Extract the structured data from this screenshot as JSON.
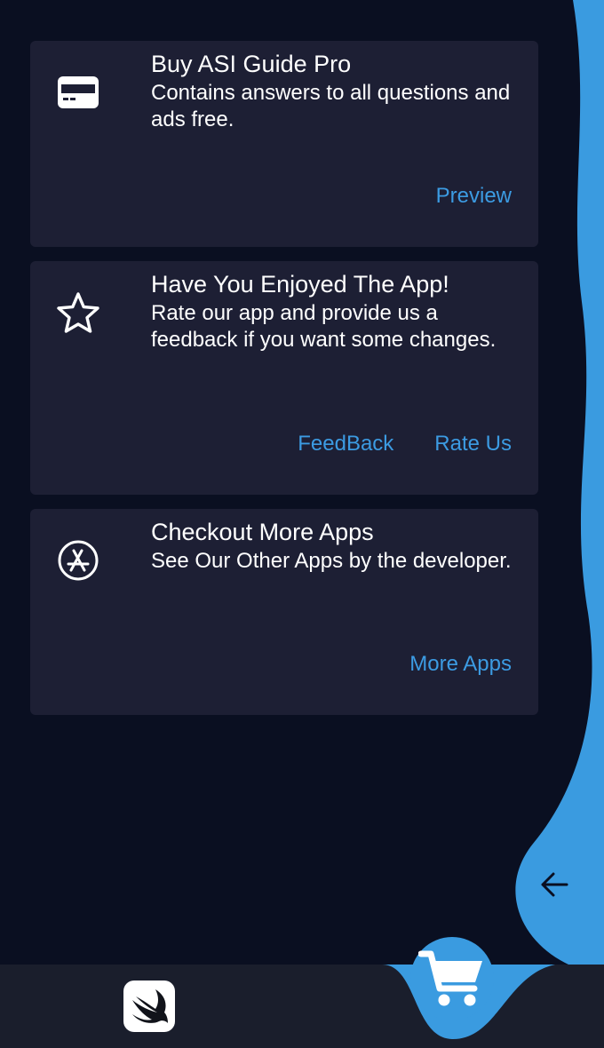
{
  "colors": {
    "background": "#0a0f21",
    "card": "#1d1f34",
    "accent": "#3c9be2",
    "bottom_bar": "#1a1e2c"
  },
  "cards": [
    {
      "icon": "card-icon",
      "title": "Buy ASI Guide Pro",
      "description": "Contains answers to all questions and ads free.",
      "actions": [
        "Preview"
      ]
    },
    {
      "icon": "star-icon",
      "title": "Have You Enjoyed The App!",
      "description": "Rate our app and provide us a feedback if you want some changes.",
      "actions": [
        "FeedBack",
        "Rate Us"
      ]
    },
    {
      "icon": "app-store-icon",
      "title": "Checkout More Apps",
      "description": "See Our Other Apps by the developer.",
      "actions": [
        "More Apps"
      ]
    }
  ],
  "navigation": {
    "back_icon": "arrow-left-icon",
    "bottom_items": [
      {
        "icon": "swift-icon",
        "active": false
      },
      {
        "icon": "shopping-cart-icon",
        "active": true
      }
    ]
  }
}
